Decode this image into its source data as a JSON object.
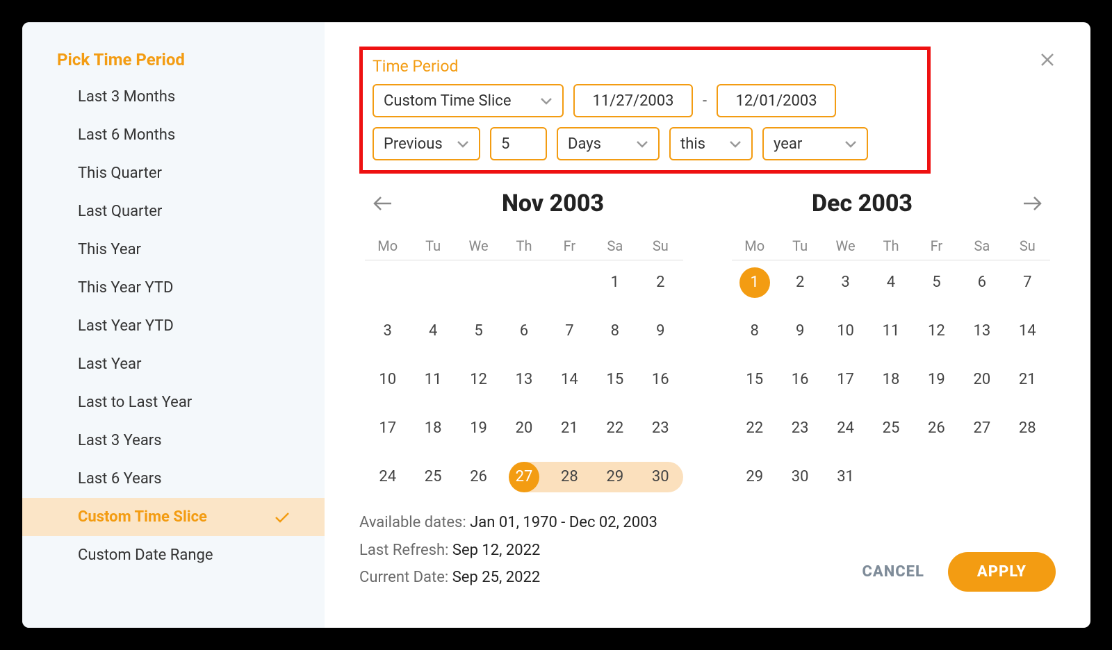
{
  "sidebar": {
    "title": "Pick Time Period",
    "items": [
      {
        "label": "Last 3 Months",
        "active": false
      },
      {
        "label": "Last 6 Months",
        "active": false
      },
      {
        "label": "This Quarter",
        "active": false
      },
      {
        "label": "Last Quarter",
        "active": false
      },
      {
        "label": "This Year",
        "active": false
      },
      {
        "label": "This Year YTD",
        "active": false
      },
      {
        "label": "Last Year YTD",
        "active": false
      },
      {
        "label": "Last Year",
        "active": false
      },
      {
        "label": "Last to Last Year",
        "active": false
      },
      {
        "label": "Last 3 Years",
        "active": false
      },
      {
        "label": "Last 6 Years",
        "active": false
      },
      {
        "label": "Custom Time Slice",
        "active": true
      },
      {
        "label": "Custom Date Range",
        "active": false
      }
    ]
  },
  "time_period": {
    "label": "Time Period",
    "type_select": "Custom Time Slice",
    "date_from": "11/27/2003",
    "date_to": "12/01/2003",
    "dash": "-",
    "direction": "Previous",
    "count": "5",
    "unit": "Days",
    "scope": "this",
    "scope_unit": "year"
  },
  "calendar": {
    "month_left": "Nov 2003",
    "month_right": "Dec 2003",
    "weekdays": [
      "Mo",
      "Tu",
      "We",
      "Th",
      "Fr",
      "Sa",
      "Su"
    ],
    "left": {
      "leading_blanks": 5,
      "days": 30,
      "range_start": 27,
      "range_end": 30
    },
    "right": {
      "leading_blanks": 0,
      "days": 31,
      "circle": 1
    }
  },
  "footer": {
    "available_label": "Available dates: ",
    "available_value": "Jan 01, 1970 - Dec 02, 2003",
    "refresh_label": "Last Refresh: ",
    "refresh_value": "Sep 12, 2022",
    "current_label": "Current Date: ",
    "current_value": "Sep 25, 2022",
    "cancel": "CANCEL",
    "apply": "APPLY"
  }
}
